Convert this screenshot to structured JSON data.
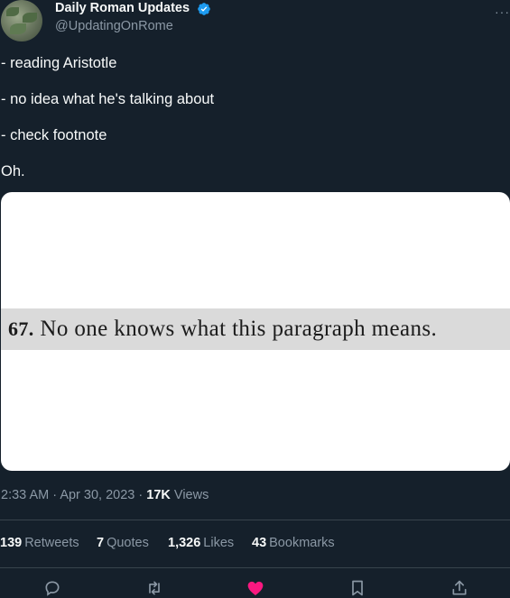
{
  "author": {
    "display_name": "Daily Roman Updates",
    "handle": "@UpdatingOnRome",
    "verified_icon": "verified-badge-icon",
    "avatar_icon": "avatar"
  },
  "tweet": {
    "lines": [
      "- reading Aristotle",
      "- no idea what he's talking about",
      "- check footnote",
      "Oh."
    ]
  },
  "media": {
    "footnote_number": "67.",
    "footnote_text": "No one knows what this paragraph means."
  },
  "meta": {
    "time": "2:33 AM",
    "separator": "·",
    "date": "Apr 30, 2023",
    "views_count": "17K",
    "views_label": "Views"
  },
  "stats": {
    "retweets_count": "139",
    "retweets_label": "Retweets",
    "quotes_count": "7",
    "quotes_label": "Quotes",
    "likes_count": "1,326",
    "likes_label": "Likes",
    "bookmarks_count": "43",
    "bookmarks_label": "Bookmarks"
  },
  "actions": [
    "reply-icon",
    "retweet-icon",
    "like-icon",
    "bookmark-icon",
    "share-icon"
  ],
  "colors": {
    "background": "#15202b",
    "text": "#f7f9f9",
    "muted": "#8b98a5",
    "verified": "#1d9bf0",
    "like": "#f91880",
    "divider": "#38444d"
  }
}
